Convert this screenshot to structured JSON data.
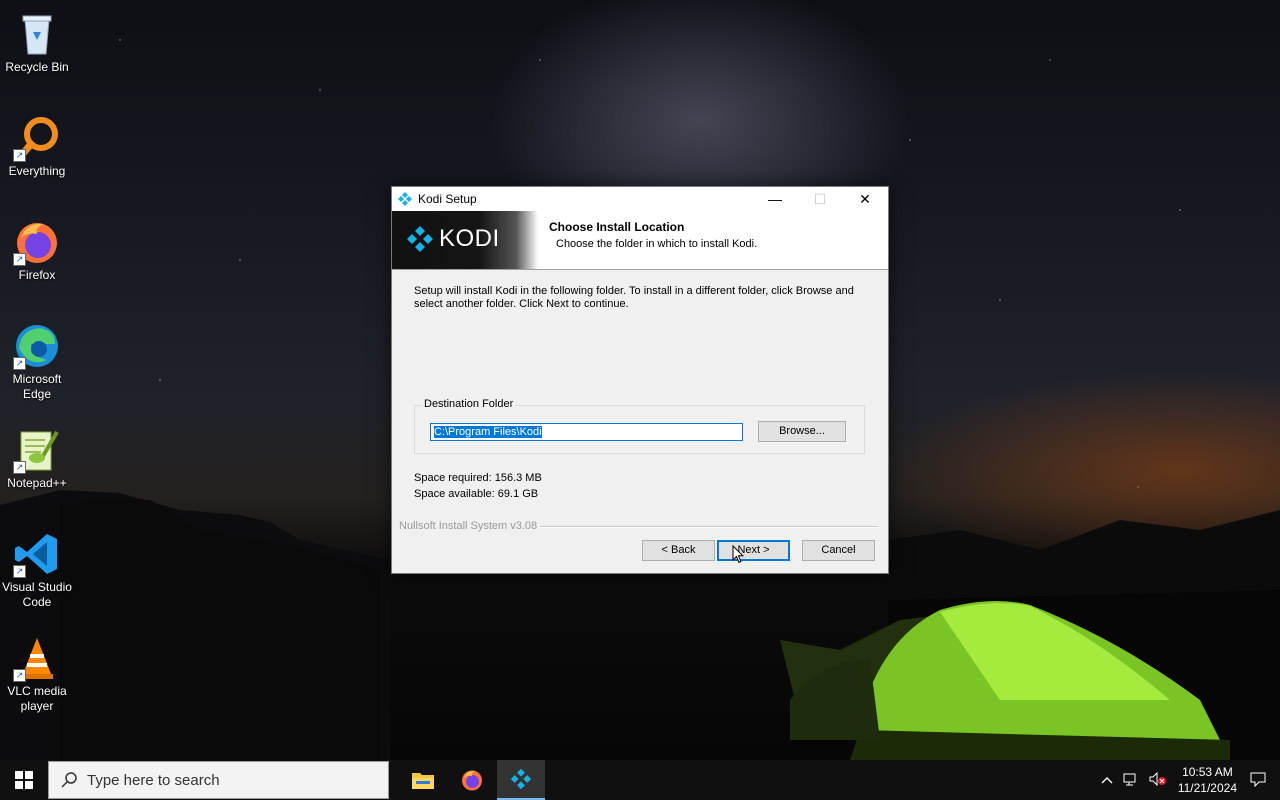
{
  "desktop": {
    "icons": [
      {
        "label": "Recycle Bin"
      },
      {
        "label": "Everything"
      },
      {
        "label": "Firefox"
      },
      {
        "label": "Microsoft Edge"
      },
      {
        "label": "Notepad++"
      },
      {
        "label": "Visual Studio Code"
      },
      {
        "label": "VLC media player"
      }
    ]
  },
  "window": {
    "title": "Kodi Setup",
    "logo_text": "KODI",
    "header_title": "Choose Install Location",
    "header_subtitle": "Choose the folder in which to install Kodi.",
    "intro_text": "Setup will install Kodi in the following folder. To install in a different folder, click Browse and select another folder. Click Next to continue.",
    "group_label": "Destination Folder",
    "destination_path": "C:\\Program Files\\Kodi",
    "browse_label": "Browse...",
    "space_required": "Space required: 156.3 MB",
    "space_available": "Space available: 69.1 GB",
    "branding": "Nullsoft Install System v3.08",
    "back_label": "< Back",
    "next_label": "Next >",
    "cancel_label": "Cancel",
    "minimize_glyph": "—",
    "maximize_glyph": "☐",
    "close_glyph": "✕"
  },
  "taskbar": {
    "search_placeholder": "Type here to search",
    "clock_time": "10:53 AM",
    "clock_date": "11/21/2024",
    "apps": [
      "file-explorer-icon",
      "firefox-icon",
      "kodi-icon"
    ]
  },
  "colors": {
    "accent": "#0078d7",
    "tent_green": "#8fdc2a"
  }
}
